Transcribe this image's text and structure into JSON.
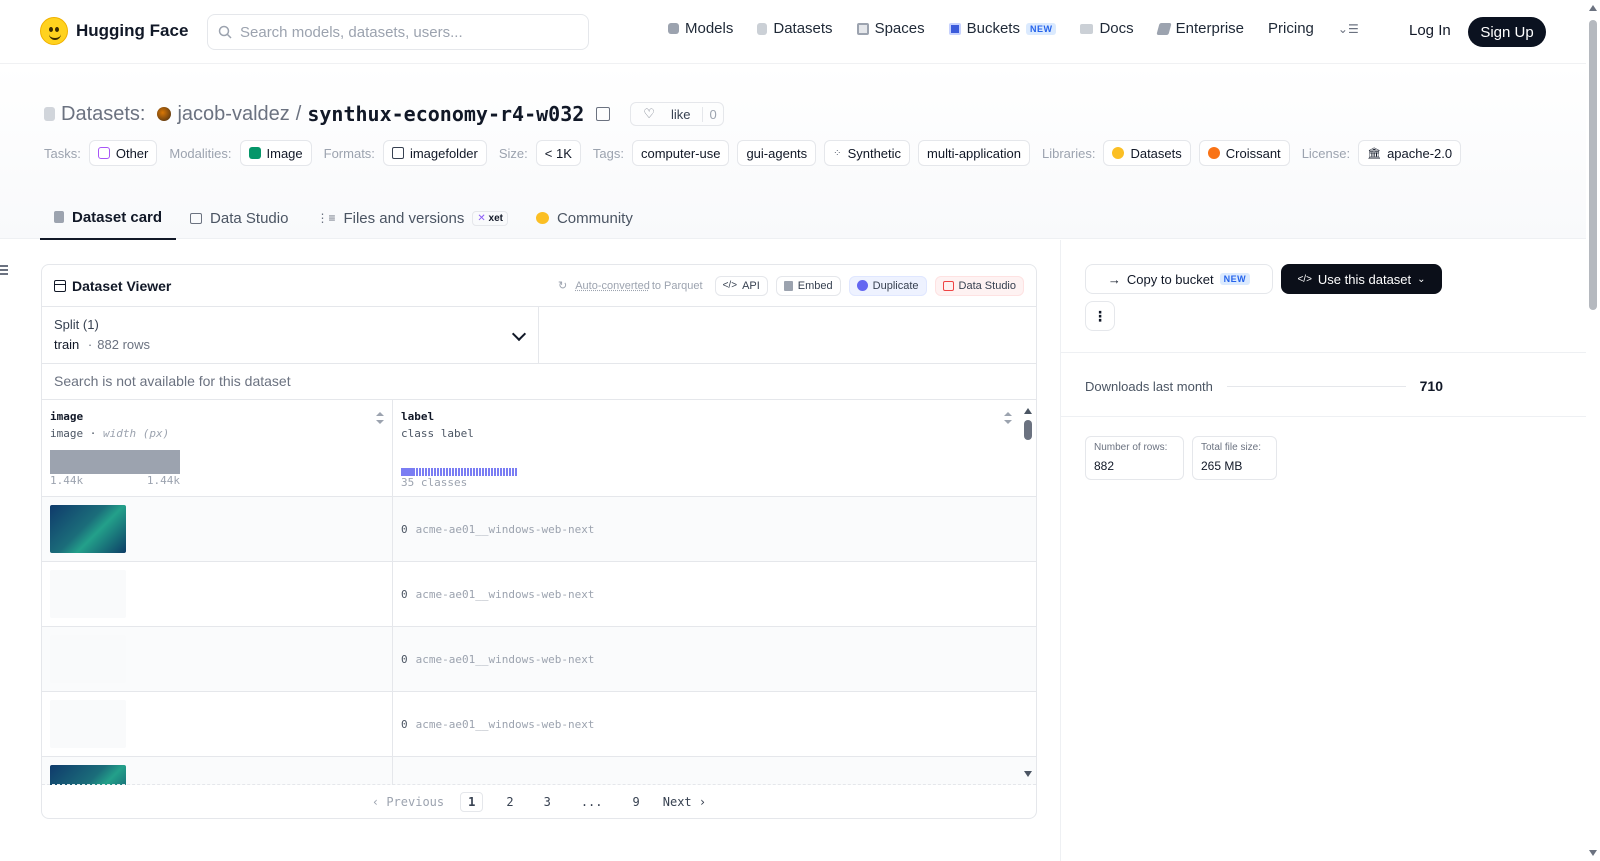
{
  "nav": {
    "logo_text": "Hugging Face",
    "search_placeholder": "Search models, datasets, users...",
    "links": [
      {
        "label": "Models",
        "icon": "cube-icon",
        "color": "#9ca3af"
      },
      {
        "label": "Datasets",
        "icon": "database-icon",
        "color": "#9ca3af"
      },
      {
        "label": "Spaces",
        "icon": "grid-icon",
        "color": "#9ca3af"
      },
      {
        "label": "Buckets",
        "icon": "bucket-icon",
        "color": "#3b5bdb"
      },
      {
        "label": "Docs",
        "icon": "book-icon",
        "color": "#9ca3af"
      },
      {
        "label": "Enterprise",
        "icon": "enterprise-icon",
        "color": "#9ca3af"
      },
      {
        "label": "Pricing",
        "icon": "",
        "color": ""
      }
    ],
    "buckets_badge": "NEW",
    "login": "Log In",
    "signup": "Sign Up"
  },
  "header": {
    "section": "Datasets:",
    "owner": "jacob-valdez",
    "separator": "/",
    "repo": "synthux-economy-r4-w032",
    "like_label": "like",
    "like_count": "0",
    "tags": {
      "tasks_label": "Tasks:",
      "tasks_value": "Other",
      "modalities_label": "Modalities:",
      "modalities_value": "Image",
      "formats_label": "Formats:",
      "formats_value": "imagefolder",
      "size_label": "Size:",
      "size_value": "< 1K",
      "tags_label": "Tags:",
      "tag_values": [
        "computer-use",
        "gui-agents",
        "Synthetic",
        "multi-application"
      ],
      "libraries_label": "Libraries:",
      "library_values": [
        "Datasets",
        "Croissant"
      ],
      "license_label": "License:",
      "license_value": "apache-2.0"
    }
  },
  "tabs": [
    {
      "label": "Dataset card",
      "active": true
    },
    {
      "label": "Data Studio",
      "active": false
    },
    {
      "label": "Files and versions",
      "active": false,
      "badge": "xet"
    },
    {
      "label": "Community",
      "active": false
    }
  ],
  "viewer": {
    "title": "Dataset Viewer",
    "auto_converted": "Auto-converted",
    "auto_converted_suffix": "to Parquet",
    "buttons": {
      "api": "API",
      "embed": "Embed",
      "duplicate": "Duplicate",
      "data_studio": "Data Studio"
    },
    "split_label": "Split (1)",
    "split_name": "train",
    "split_sep": "·",
    "split_rows": "882 rows",
    "search_na": "Search is not available for this dataset",
    "columns": [
      {
        "name": "image",
        "type": "image",
        "type_extra": "width (px)",
        "hist_min": "1.44k",
        "hist_max": "1.44k"
      },
      {
        "name": "label",
        "type": "class label",
        "classes": "35 classes"
      }
    ],
    "rows": [
      {
        "has_image": true,
        "label_idx": "0",
        "label": "acme-ae01__windows-web-next"
      },
      {
        "has_image": false,
        "label_idx": "0",
        "label": "acme-ae01__windows-web-next"
      },
      {
        "has_image": false,
        "label_idx": "0",
        "label": "acme-ae01__windows-web-next"
      },
      {
        "has_image": false,
        "label_idx": "0",
        "label": "acme-ae01__windows-web-next"
      },
      {
        "has_image": true,
        "label_idx": "",
        "label": ""
      }
    ],
    "pager": {
      "previous": "Previous",
      "pages": [
        "1",
        "2",
        "3",
        "...",
        "9"
      ],
      "next": "Next",
      "current": "1"
    }
  },
  "sidebar": {
    "copy_bucket": "Copy to bucket",
    "copy_bucket_badge": "NEW",
    "use_dataset": "Use this dataset",
    "more": "⋮",
    "downloads_label": "Downloads last month",
    "downloads_value": "710",
    "rows_label": "Number of rows:",
    "rows_value": "882",
    "size_label": "Total file size:",
    "size_value": "265 MB"
  }
}
